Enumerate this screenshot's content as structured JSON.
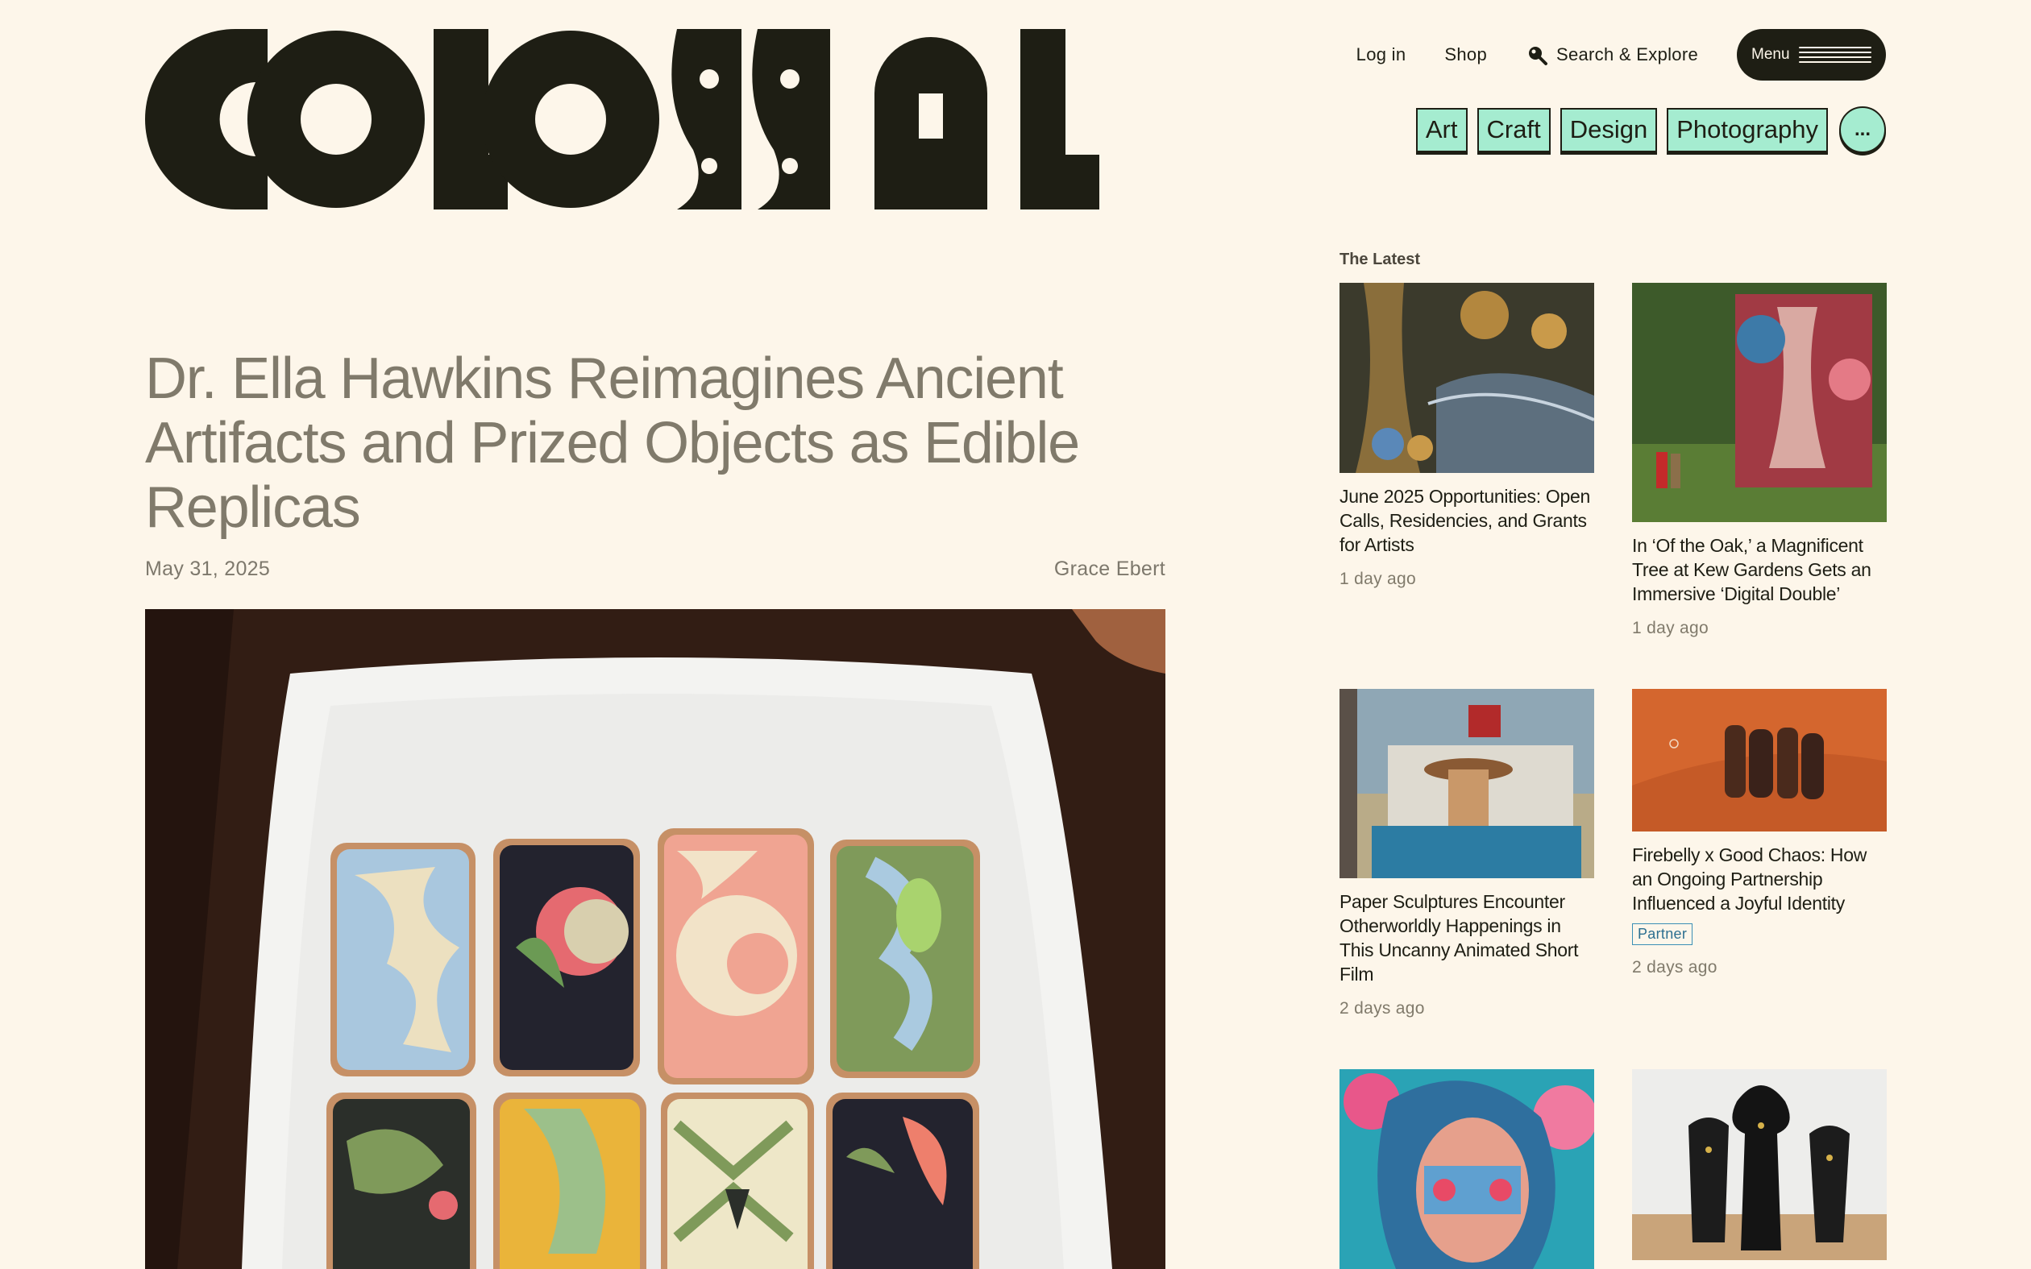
{
  "brand": {
    "logo_text": "COLOSSAL"
  },
  "nav": {
    "login": "Log in",
    "shop": "Shop",
    "search": "Search & Explore",
    "menu": "Menu"
  },
  "categories": [
    "Art",
    "Craft",
    "Design",
    "Photography"
  ],
  "categories_more": "...",
  "article": {
    "title": "Dr. Ella Hawkins Reimagines Ancient Artifacts and Prized Objects as Edible Replicas",
    "date": "May 31, 2025",
    "author": "Grace Ebert"
  },
  "sidebar": {
    "label": "The Latest",
    "cards": [
      {
        "title": "June 2025 Opportunities: Open Calls, Residencies, and Grants for Artists",
        "time": "1 day ago"
      },
      {
        "title": "In ‘Of the Oak,’ a Magnificent Tree at Kew Gardens Gets an Immersive ‘Digital Double’",
        "time": "1 day ago"
      },
      {
        "title": "Paper Sculptures Encounter Otherworldly Happenings in This Uncanny Animated Short Film",
        "time": "2 days ago"
      },
      {
        "title": "Firebelly x Good Chaos: How an Ongoing Partnership Influenced a Joyful Identity",
        "badge": "Partner",
        "time": "2 days ago"
      }
    ]
  },
  "colors": {
    "background": "#fdf6ea",
    "ink": "#1e1e14",
    "chip": "#a5ecd0",
    "title_gray": "#807a6b",
    "partner_blue": "#3b8fb5"
  },
  "icons": [
    "search-icon",
    "hamburger-icon",
    "more-icon"
  ]
}
